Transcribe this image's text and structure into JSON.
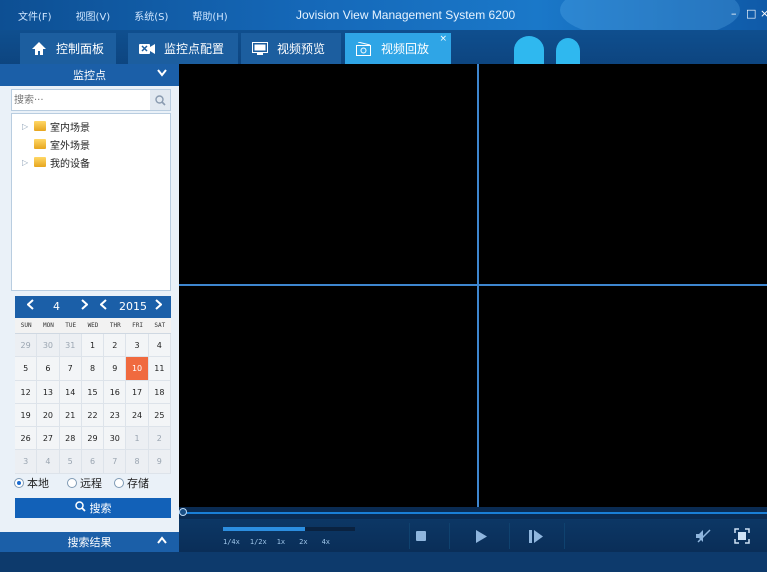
{
  "menu": [
    "文件(F)",
    "视图(V)",
    "系统(S)",
    "帮助(H)"
  ],
  "app_title": "Jovision View Management System 6200",
  "window_controls": {
    "minimize": "–",
    "maximize": "□",
    "close": "×"
  },
  "tabs": [
    {
      "label": "控制面板",
      "icon": "home-icon"
    },
    {
      "label": "监控点配置",
      "icon": "camera-config-icon"
    },
    {
      "label": "视频预览",
      "icon": "monitor-icon"
    },
    {
      "label": "视频回放",
      "icon": "playback-icon",
      "active": true,
      "close": "×"
    }
  ],
  "sidebar": {
    "monitor_points": {
      "title": "监控点",
      "chevron": "chevron-down-icon"
    },
    "search": {
      "placeholder": "搜索···",
      "icon": "search-icon"
    },
    "tree": [
      {
        "label": "室内场景",
        "expandable": true
      },
      {
        "label": "室外场景",
        "expandable": false
      },
      {
        "label": "我的设备",
        "expandable": true
      }
    ],
    "calendar": {
      "month": "4",
      "year": "2015",
      "prev": "‹",
      "next": "›",
      "weekdays": [
        "SUN",
        "MON",
        "TUE",
        "WED",
        "THR",
        "FRI",
        "SAT"
      ],
      "days": [
        {
          "d": "29",
          "o": true
        },
        {
          "d": "30",
          "o": true
        },
        {
          "d": "31",
          "o": true
        },
        {
          "d": "1"
        },
        {
          "d": "2"
        },
        {
          "d": "3"
        },
        {
          "d": "4"
        },
        {
          "d": "5"
        },
        {
          "d": "6"
        },
        {
          "d": "7"
        },
        {
          "d": "8"
        },
        {
          "d": "9"
        },
        {
          "d": "10",
          "sel": true
        },
        {
          "d": "11"
        },
        {
          "d": "12"
        },
        {
          "d": "13"
        },
        {
          "d": "14"
        },
        {
          "d": "15"
        },
        {
          "d": "16"
        },
        {
          "d": "17"
        },
        {
          "d": "18"
        },
        {
          "d": "19"
        },
        {
          "d": "20"
        },
        {
          "d": "21"
        },
        {
          "d": "22"
        },
        {
          "d": "23"
        },
        {
          "d": "24"
        },
        {
          "d": "25"
        },
        {
          "d": "26"
        },
        {
          "d": "27"
        },
        {
          "d": "28"
        },
        {
          "d": "29"
        },
        {
          "d": "30"
        },
        {
          "d": "1",
          "o": true
        },
        {
          "d": "2",
          "o": true
        },
        {
          "d": "3",
          "o": true
        },
        {
          "d": "4",
          "o": true
        },
        {
          "d": "5",
          "o": true
        },
        {
          "d": "6",
          "o": true
        },
        {
          "d": "7",
          "o": true
        },
        {
          "d": "8",
          "o": true
        },
        {
          "d": "9",
          "o": true
        }
      ]
    },
    "sources": [
      {
        "label": "本地",
        "selected": true
      },
      {
        "label": "远程",
        "selected": false
      },
      {
        "label": "存储",
        "selected": false
      }
    ],
    "search_button": "搜索",
    "results": {
      "title": "搜索结果",
      "chevron": "chevron-up-icon"
    }
  },
  "playback": {
    "speeds": [
      "1/4x",
      "1/2x",
      "1x",
      "2x",
      "4x"
    ],
    "speed_level": 0.62,
    "timeline_position": 0,
    "controls": [
      "stop-icon",
      "play-icon",
      "step-forward-icon",
      "mute-icon",
      "fullscreen-icon"
    ]
  },
  "colors": {
    "accent": "#1b5fa8",
    "tab_active": "#2fa5e6",
    "selected_day": "#f06a3f",
    "grid_line": "#3e86cf"
  }
}
